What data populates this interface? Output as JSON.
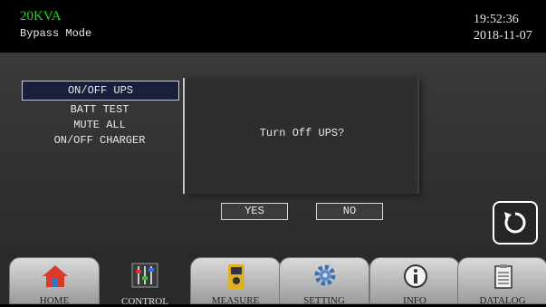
{
  "header": {
    "model": "20KVA",
    "mode": "Bypass Mode",
    "time": "19:52:36",
    "date": "2018-11-07"
  },
  "control_menu": {
    "items": [
      {
        "label": "ON/OFF UPS",
        "selected": true
      },
      {
        "label": "BATT TEST",
        "selected": false
      },
      {
        "label": "MUTE ALL",
        "selected": false
      },
      {
        "label": "ON/OFF CHARGER",
        "selected": false
      }
    ]
  },
  "dialog": {
    "message": "Turn Off UPS?",
    "yes_label": "YES",
    "no_label": "NO"
  },
  "refresh": {
    "icon": "refresh-icon"
  },
  "nav": {
    "active": "CONTROL",
    "tabs": [
      {
        "label": "HOME",
        "icon": "home-icon"
      },
      {
        "label": "CONTROL",
        "icon": "sliders-icon"
      },
      {
        "label": "MEASURE",
        "icon": "multimeter-icon"
      },
      {
        "label": "SETTING",
        "icon": "gear-icon"
      },
      {
        "label": "INFO",
        "icon": "info-icon"
      },
      {
        "label": "DATALOG",
        "icon": "clipboard-icon"
      }
    ]
  },
  "colors": {
    "model_text": "#18e018",
    "background": "#000000",
    "panel": "#333333",
    "menu_selected_bg": "#1a1f3c"
  }
}
